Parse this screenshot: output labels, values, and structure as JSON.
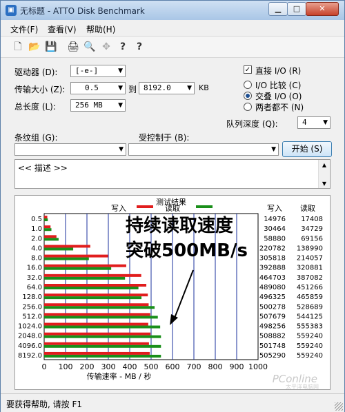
{
  "window": {
    "title": "无标题 - ATTO Disk Benchmark"
  },
  "menu": [
    "文件(F)",
    "查看(V)",
    "帮助(H)"
  ],
  "toolbar": {
    "icons": [
      "new-file-icon",
      "open-folder-icon",
      "save-icon",
      "print-icon",
      "print-preview-icon",
      "move-icon",
      "help-icon",
      "context-help-icon"
    ],
    "glyphs": [
      "🗋",
      "📂",
      "💾",
      "🖨",
      "🔍",
      "✥",
      "?",
      "?"
    ]
  },
  "settings": {
    "drive_label": "驱动器 (D):",
    "drive_value": "[-e-]",
    "transfer_label": "传输大小 (Z):",
    "transfer_from": "0.5",
    "to_label": "到",
    "transfer_to": "8192.0",
    "transfer_unit": "KB",
    "length_label": "总长度 (L):",
    "length_value": "256 MB",
    "direct_io_label": "直接 I/O (R)",
    "direct_io_checked": true,
    "io_compare_label": "I/O 比较 (C)",
    "overlap_io_label": "交叠 I/O (O)",
    "neither_label": "两者都不 (N)",
    "selected_io": "overlap",
    "queue_label": "队列深度 (Q):",
    "queue_value": "4",
    "stripe_label": "条纹组 (G):",
    "controlled_label": "受控制于 (B):",
    "start_label": "开始 (S)",
    "description": "<< 描述 >>"
  },
  "chart_data": {
    "type": "bar",
    "title": "测试结果",
    "legend": [
      {
        "name": "写入",
        "color": "#e11d1d"
      },
      {
        "name": "读取",
        "color": "#1a8f1a"
      }
    ],
    "categories": [
      "0.5",
      "1.0",
      "2.0",
      "4.0",
      "8.0",
      "16.0",
      "32.0",
      "64.0",
      "128.0",
      "256.0",
      "512.0",
      "1024.0",
      "2048.0",
      "4096.0",
      "8192.0"
    ],
    "series": [
      {
        "name": "写入",
        "values": [
          14976,
          30464,
          58880,
          220782,
          305818,
          392888,
          464703,
          489080,
          496325,
          500278,
          507679,
          498256,
          508882,
          501748,
          505290
        ]
      },
      {
        "name": "读取",
        "values": [
          17408,
          34729,
          69156,
          138990,
          214057,
          320881,
          387082,
          451266,
          465859,
          528689,
          544125,
          555383,
          559240,
          559240,
          559240
        ]
      }
    ],
    "write_header": "写入",
    "read_header": "读取",
    "xlabel": "传输速率 - MB / 秒",
    "xticks": [
      0,
      100,
      200,
      300,
      400,
      500,
      600,
      700,
      800,
      900,
      1000
    ],
    "xlim": [
      0,
      1000
    ],
    "value_unit_divisor": 1024,
    "annotation": [
      "持续读取速度",
      "突破500MB/s"
    ]
  },
  "watermark": {
    "text": "PConline",
    "sub": "太平洋电脑网"
  },
  "status": {
    "text": "要获得帮助, 请按 F1"
  }
}
